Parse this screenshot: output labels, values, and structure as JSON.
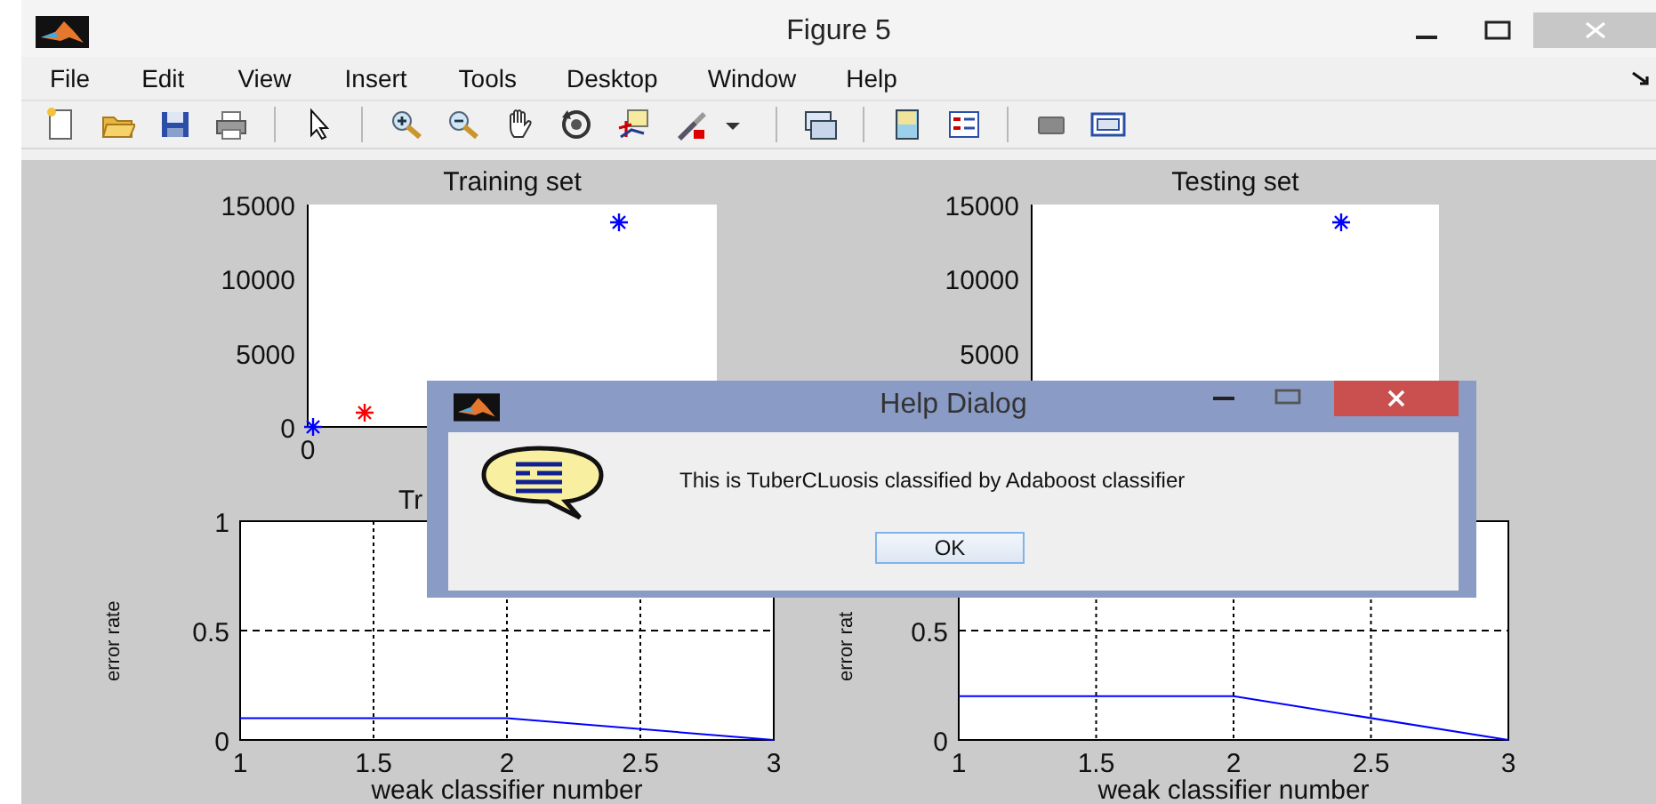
{
  "window": {
    "title": "Figure 5"
  },
  "menu": [
    "File",
    "Edit",
    "View",
    "Insert",
    "Tools",
    "Desktop",
    "Window",
    "Help"
  ],
  "top_plots": [
    {
      "title": "Training set",
      "y_tick_labels": [
        "15000",
        "10000",
        "5000",
        "0"
      ],
      "x_tick_labels": [
        "0"
      ]
    },
    {
      "title": "Testing set",
      "y_tick_labels": [
        "15000",
        "10000",
        "5000"
      ]
    }
  ],
  "bottom_plots": [
    {
      "title": "Tr",
      "chart_data": {
        "type": "line",
        "grid": true,
        "xlabel": "weak classifier number",
        "ylabel": "error rate",
        "x": [
          1,
          2,
          3
        ],
        "series": [
          {
            "color": "#0000ff",
            "values": [
              0.1,
              0.1,
              0
            ]
          }
        ],
        "xlim": [
          1,
          3
        ],
        "ylim": [
          0,
          1
        ],
        "xticks": [
          1,
          1.5,
          2,
          2.5,
          3
        ],
        "yticks": [
          0,
          0.5,
          1
        ]
      }
    },
    {
      "chart_data": {
        "type": "line",
        "grid": true,
        "xlabel": "weak classifier number",
        "ylabel": "error rat",
        "x": [
          1,
          2,
          3
        ],
        "series": [
          {
            "color": "#0000ff",
            "values": [
              0.2,
              0.2,
              0
            ]
          }
        ],
        "xlim": [
          1,
          3
        ],
        "ylim": [
          0,
          1
        ],
        "xticks": [
          1,
          1.5,
          2,
          2.5,
          3
        ],
        "yticks": [
          0,
          0.5
        ]
      }
    }
  ],
  "dialog": {
    "title": "Help Dialog",
    "message": "This is TuberCLuosis classified by Adaboost classifier",
    "buttons": [
      "OK"
    ]
  }
}
